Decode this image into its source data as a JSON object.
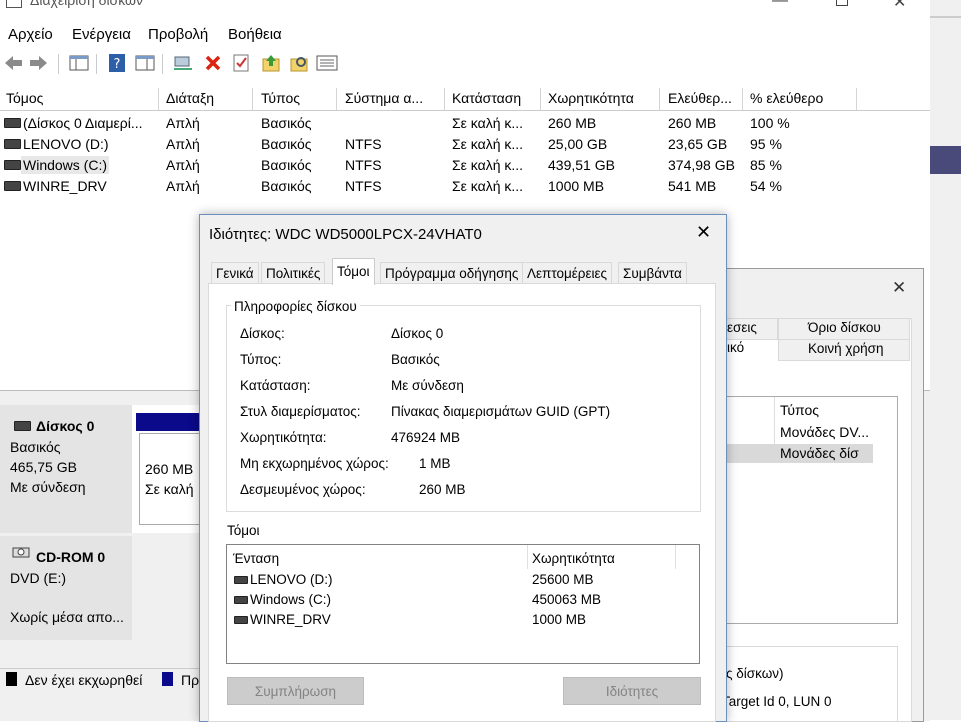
{
  "window": {
    "title": "Διαχείριση δίσκων"
  },
  "menu": [
    "Αρχείο",
    "Ενέργεια",
    "Προβολή",
    "Βοήθεια"
  ],
  "toolbar_icons": [
    "back-arrow-icon",
    "forward-arrow-icon",
    "console-tree-icon",
    "help-icon",
    "properties-view-icon",
    "connect-icon",
    "delete-icon",
    "check-icon",
    "folder-up-icon",
    "folder-search-icon",
    "list-view-icon"
  ],
  "volume_columns": [
    "Τόμος",
    "Διάταξη",
    "Τύπος",
    "Σύστημα α...",
    "Κατάσταση",
    "Χωρητικότητα",
    "Ελεύθερ...",
    "% ελεύθερο"
  ],
  "volumes": [
    {
      "name": "(Δίσκος 0 Διαμερί...",
      "layout": "Απλή",
      "type": "Βασικός",
      "fs": "",
      "status": "Σε καλή κ...",
      "capacity": "260 MB",
      "free": "260 MB",
      "pct": "100 %"
    },
    {
      "name": "LENOVO (D:)",
      "layout": "Απλή",
      "type": "Βασικός",
      "fs": "NTFS",
      "status": "Σε καλή κ...",
      "capacity": "25,00 GB",
      "free": "23,65 GB",
      "pct": "95 %"
    },
    {
      "name": "Windows (C:)",
      "layout": "Απλή",
      "type": "Βασικός",
      "fs": "NTFS",
      "status": "Σε καλή κ...",
      "capacity": "439,51 GB",
      "free": "374,98 GB",
      "pct": "85 %"
    },
    {
      "name": "WINRE_DRV",
      "layout": "Απλή",
      "type": "Βασικός",
      "fs": "NTFS",
      "status": "Σε καλή κ...",
      "capacity": "1000 MB",
      "free": "541 MB",
      "pct": "54 %"
    }
  ],
  "disks": [
    {
      "name": "Δίσκος 0",
      "type": "Βασικός",
      "size": "465,75 GB",
      "state": "Με σύνδεση",
      "part_size": "260 MB",
      "part_state": "Σε καλή"
    },
    {
      "name": "CD-ROM 0",
      "type": "DVD (E:)",
      "state": "Χωρίς μέσα απο..."
    }
  ],
  "legend": {
    "unallocated": "Δεν έχει εκχωρηθεί",
    "primary": "Πρ"
  },
  "back_dialog": {
    "tabs": [
      "εσεις",
      "Όριο δίσκου",
      "ικό",
      "Κοινή χρήση"
    ],
    "col_type": "Τύπος",
    "rows": [
      "Μονάδες DV...",
      "Μονάδες δίσ"
    ],
    "foot1": "ες δίσκων)",
    "foot2": "Target Id 0, LUN 0"
  },
  "dialog": {
    "title": "Ιδιότητες: WDC WD5000LPCX-24VHAT0",
    "tabs": [
      "Γενικά",
      "Πολιτικές",
      "Τόμοι",
      "Πρόγραμμα οδήγησης",
      "Λεπτομέρειες",
      "Συμβάντα"
    ],
    "info_group": "Πληροφορίες δίσκου",
    "info": [
      {
        "label": "Δίσκος:",
        "value": "Δίσκος 0"
      },
      {
        "label": "Τύπος:",
        "value": "Βασικός"
      },
      {
        "label": "Κατάσταση:",
        "value": "Με σύνδεση"
      },
      {
        "label": "Στυλ διαμερίσματος:",
        "value": "Πίνακας διαμερισμάτων GUID (GPT)"
      },
      {
        "label": "Χωρητικότητα:",
        "value": "476924 MB"
      },
      {
        "label": "Μη εκχωρημένος χώρος:",
        "value": "1 MB"
      },
      {
        "label": "Δεσμευμένος χώρος:",
        "value": "260 MB"
      }
    ],
    "volumes_group": "Τόμοι",
    "vol_cols": [
      "Ένταση",
      "Χωρητικότητα"
    ],
    "vol_rows": [
      {
        "name": "LENOVO (D:)",
        "cap": "25600 MB"
      },
      {
        "name": "Windows (C:)",
        "cap": "450063 MB"
      },
      {
        "name": "WINRE_DRV",
        "cap": "1000 MB"
      }
    ],
    "btn_populate": "Συμπλήρωση",
    "btn_properties": "Ιδιότητες"
  }
}
